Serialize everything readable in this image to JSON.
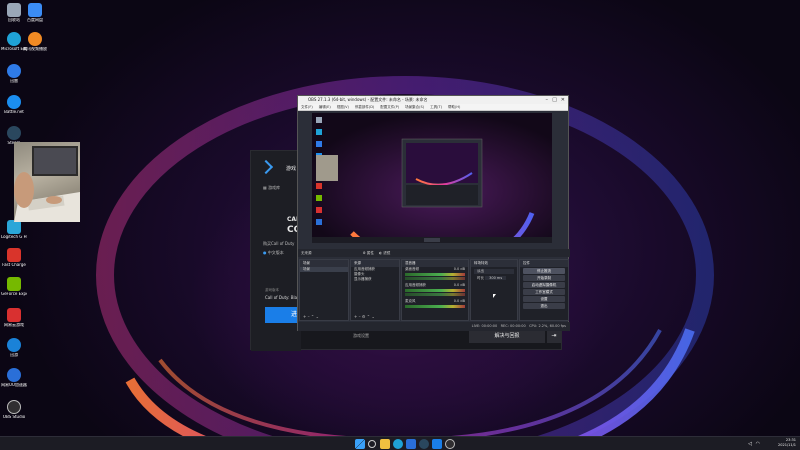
{
  "desktop": {
    "icons": [
      {
        "label": "回收站",
        "icon": "recycle-bin-icon",
        "color": "#9aa7b8"
      },
      {
        "label": "百度网盘",
        "icon": "cloud-drive-icon",
        "color": "#3b8cf5"
      },
      {
        "label": "Microsoft Edge",
        "icon": "edge-icon",
        "color": "#1fa2d6"
      },
      {
        "label": "腾讯视频播放",
        "icon": "video-player-icon",
        "color": "#f08a24"
      },
      {
        "label": "迅雷",
        "icon": "thunder-icon",
        "color": "#2f7be8"
      },
      {
        "label": "Battle.net",
        "icon": "battlenet-icon",
        "color": "#1b8ef0"
      },
      {
        "label": "Steam",
        "icon": "steam-icon",
        "color": "#2a475e"
      },
      {
        "label": "Logitech G HUB",
        "icon": "ghub-icon",
        "color": "#2aa6d8"
      },
      {
        "label": "Fast Charge",
        "icon": "fast-charge-icon",
        "color": "#d9342b"
      },
      {
        "label": "GeForce Experience",
        "icon": "geforce-icon",
        "color": "#76b900"
      },
      {
        "label": "网易云游戏",
        "icon": "netease-game-icon",
        "color": "#d93030"
      },
      {
        "label": "迅游",
        "icon": "booster-icon",
        "color": "#1a82d8"
      },
      {
        "label": "网易UU加速器",
        "icon": "uu-booster-icon",
        "color": "#2a6fd8"
      },
      {
        "label": "OBS Studio",
        "icon": "obs-icon",
        "color": "#302e31"
      }
    ]
  },
  "launcher": {
    "brand": "游戏",
    "nav_item": "游戏库",
    "game_title_1": "CALL OF",
    "game_title_2": "COD",
    "game_line": "购买Call of Duty",
    "tag": "中文版本",
    "version_label": "游戏版本",
    "version_value": "Call of Duty: Bla...",
    "play_label": "进入",
    "settings_label": "游戏设置",
    "download_button": "解决与回报",
    "accent": "#1a7ee8"
  },
  "obs": {
    "title": "OBS 27.1.3 (64-bit, windows) - 配置文件: 未命名 - 场景: 未命名",
    "menu": [
      "文件(F)",
      "编辑(E)",
      "视图(V)",
      "停靠部件(D)",
      "配置文件(P)",
      "场景集合(S)",
      "工具(T)",
      "帮助(H)"
    ],
    "dock_bar_label": "无来源",
    "dock_bar_tabs": [
      "属性",
      "滤镜"
    ],
    "scenes": {
      "head": "场景",
      "items": [
        "场景"
      ]
    },
    "sources": {
      "head": "来源",
      "items": [
        "应用音频捕获",
        "摄像头",
        "显示器捕获"
      ]
    },
    "mixer": {
      "head": "混音器",
      "channels": [
        {
          "name": "桌面音频",
          "level": "0.0 dB"
        },
        {
          "name": "应用音频捕获",
          "level": "0.0 dB"
        },
        {
          "name": "麦克风",
          "level": "0.0 dB"
        }
      ]
    },
    "transitions": {
      "head": "转场特效",
      "type": "淡出",
      "duration_label": "时长",
      "duration": "300 ms"
    },
    "controls": {
      "head": "控件",
      "buttons": [
        "停止推流",
        "开始录制",
        "启动虚拟摄像机",
        "工作室模式",
        "设置",
        "退出"
      ]
    },
    "status": {
      "live": "LIVE: 00:00:00",
      "rec": "REC: 00:00:00",
      "cpu": "CPU: 2.2%, 60.00 fps"
    }
  },
  "taskbar": {
    "icons": [
      "windows-start-icon",
      "search-icon",
      "file-explorer-icon",
      "edge-icon",
      "store-icon",
      "steam-icon",
      "launcher-icon",
      "obs-icon"
    ],
    "time": "23:31",
    "date": "2021/11/1"
  }
}
